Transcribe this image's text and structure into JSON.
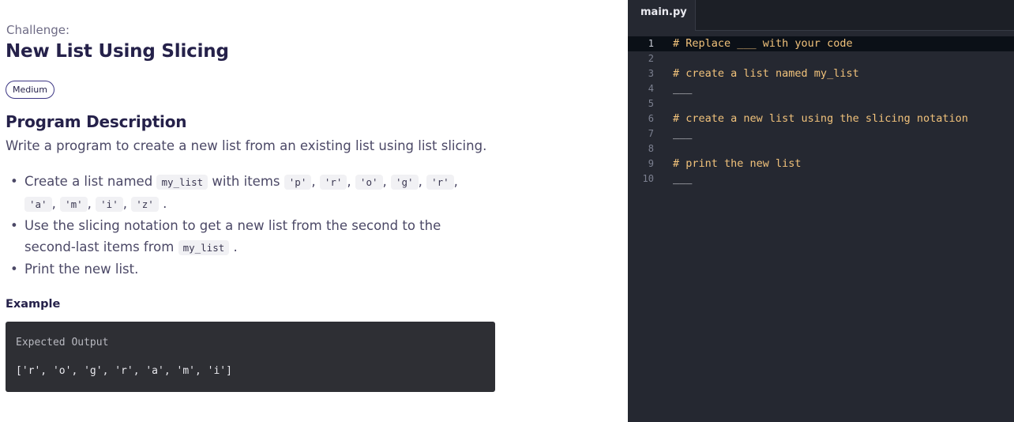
{
  "problem": {
    "label": "Challenge:",
    "title": "New List Using Slicing",
    "difficulty": "Medium",
    "section_heading": "Program Description",
    "intro": "Write a program to create a new list from an existing list using list slicing.",
    "bullet1": {
      "t1": "Create a list named",
      "c1": "my_list",
      "t2": "with items",
      "c2": "'p'",
      "c3": "'r'",
      "c4": "'o'",
      "c5": "'g'",
      "c6": "'r'",
      "c7": "'a'",
      "c8": "'m'",
      "c9": "'i'",
      "c10": "'z'",
      "comma": ",",
      "end": "."
    },
    "bullet2": {
      "line1": "Use the slicing notation to get a new list from the second to the",
      "t1": "second-last items from",
      "c1": "my_list",
      "end": "."
    },
    "bullet3": "Print the new list.",
    "example_label": "Example",
    "expected_label": "Expected Output",
    "expected_value": "['r', 'o', 'g', 'r', 'a', 'm', 'i']"
  },
  "editor": {
    "tab": "main.py",
    "lines": [
      {
        "num": "1",
        "text": "# Replace ___ with your code"
      },
      {
        "num": "2",
        "text": ""
      },
      {
        "num": "3",
        "text": "# create a list named my_list"
      },
      {
        "num": "4",
        "text": "___"
      },
      {
        "num": "5",
        "text": ""
      },
      {
        "num": "6",
        "text": "# create a new list using the slicing notation"
      },
      {
        "num": "7",
        "text": "___"
      },
      {
        "num": "8",
        "text": ""
      },
      {
        "num": "9",
        "text": "# print the new list"
      },
      {
        "num": "10",
        "text": "___"
      }
    ]
  },
  "colors": {
    "heading": "#25214a",
    "body_text": "#4b4866",
    "editor_bg": "#252831",
    "comment": "#f1c27b"
  }
}
